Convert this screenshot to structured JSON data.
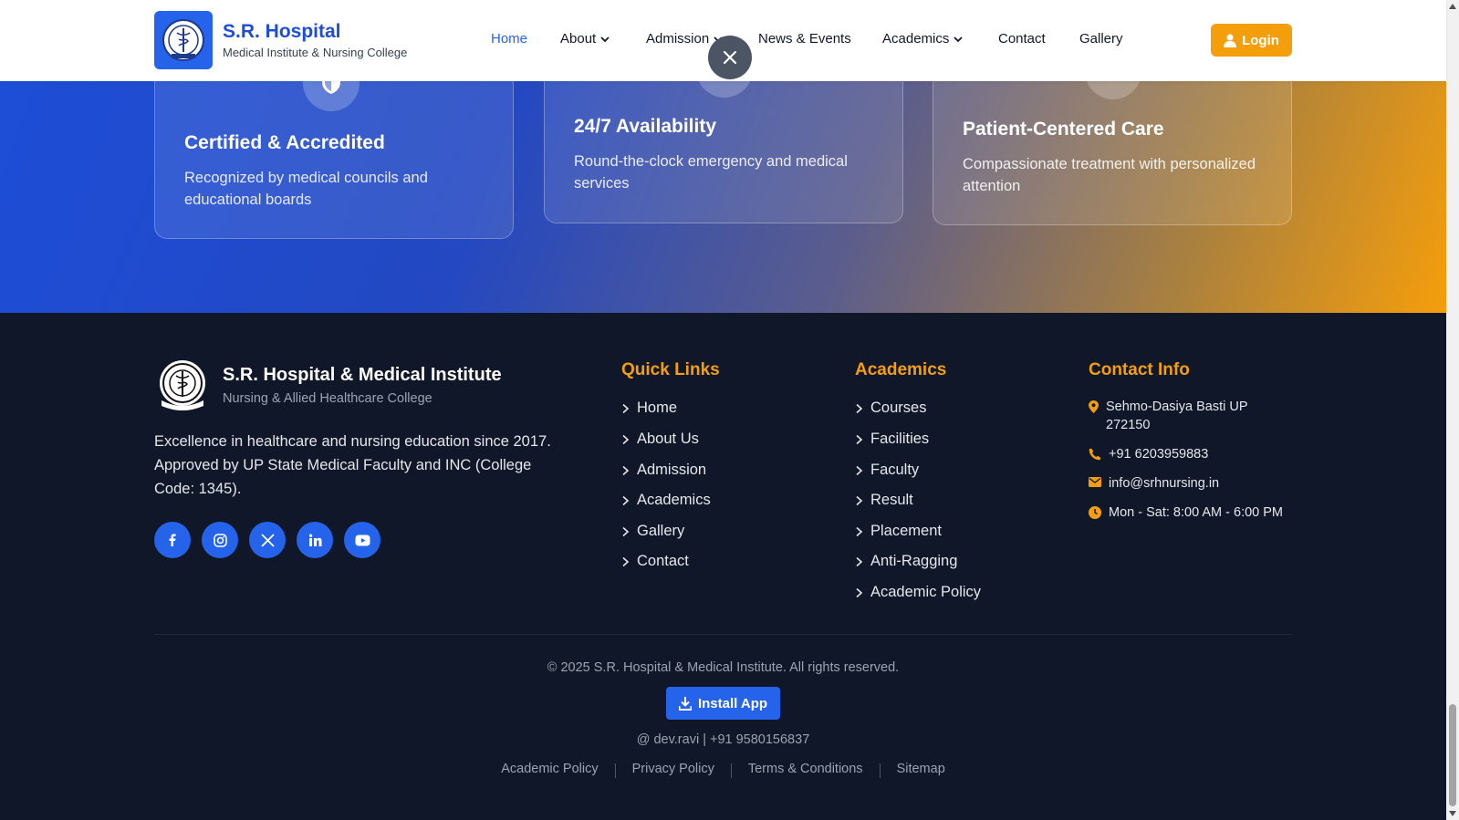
{
  "header": {
    "brand_title": "S.R. Hospital",
    "brand_subtitle": "Medical Institute & Nursing College",
    "nav": [
      {
        "label": "Home",
        "active": true,
        "dropdown": false
      },
      {
        "label": "About",
        "active": false,
        "dropdown": true
      },
      {
        "label": "Admission",
        "active": false,
        "dropdown": true
      },
      {
        "label": "News & Events",
        "active": false,
        "dropdown": false
      },
      {
        "label": "Academics",
        "active": false,
        "dropdown": true
      },
      {
        "label": "Contact",
        "active": false,
        "dropdown": false
      },
      {
        "label": "Gallery",
        "active": false,
        "dropdown": false
      }
    ],
    "login_label": "Login"
  },
  "features": [
    {
      "title": "Certified & Accredited",
      "description": "Recognized by medical councils and educational boards",
      "icon": "shield-icon"
    },
    {
      "title": "24/7 Availability",
      "description": "Round-the-clock emergency and medical services",
      "icon": "clock-icon"
    },
    {
      "title": "Patient-Centered Care",
      "description": "Compassionate treatment with personalized attention",
      "icon": "care-icon"
    }
  ],
  "footer": {
    "brand_title": "S.R. Hospital & Medical Institute",
    "brand_subtitle": "Nursing & Allied Healthcare College",
    "description": "Excellence in healthcare and nursing education since 2017. Approved by UP State Medical Faculty and INC (College Code: 1345).",
    "social": [
      "facebook-icon",
      "instagram-icon",
      "x-icon",
      "linkedin-icon",
      "youtube-icon"
    ],
    "quick_links": {
      "heading": "Quick Links",
      "items": [
        "Home",
        "About Us",
        "Admission",
        "Academics",
        "Gallery",
        "Contact"
      ]
    },
    "academics": {
      "heading": "Academics",
      "items": [
        "Courses",
        "Facilities",
        "Faculty",
        "Result",
        "Placement",
        "Anti-Ragging",
        "Academic Policy"
      ]
    },
    "contact": {
      "heading": "Contact Info",
      "address_line1": "Sehmo-Dasiya Basti UP",
      "address_line2": "272150",
      "phone": "+91 6203959883",
      "email": "info@srhnursing.in",
      "hours": "Mon - Sat: 8:00 AM - 6:00 PM"
    },
    "copyright": "© 2025 S.R. Hospital & Medical Institute. All rights reserved.",
    "install_label": "Install App",
    "developer": "@ dev.ravi | +91 9580156837",
    "bottom_links": [
      "Academic Policy",
      "Privacy Policy",
      "Terms & Conditions",
      "Sitemap"
    ]
  },
  "colors": {
    "primary": "#2563eb",
    "accent": "#f59e0b",
    "footer_bg": "#0f1729"
  }
}
